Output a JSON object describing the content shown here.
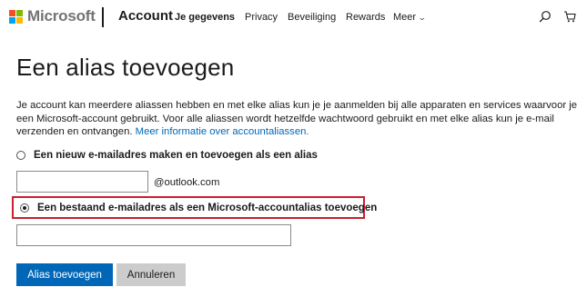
{
  "header": {
    "brand": "Microsoft",
    "section": "Account",
    "nav": [
      {
        "label": "Je gegevens",
        "active": true
      },
      {
        "label": "Privacy",
        "active": false
      },
      {
        "label": "Beveiliging",
        "active": false
      },
      {
        "label": "Rewards",
        "active": false
      },
      {
        "label": "Meer",
        "active": false
      }
    ],
    "icons": [
      "search-icon",
      "cart-icon",
      "chevron-down-icon"
    ]
  },
  "page": {
    "title": "Een alias toevoegen",
    "description": "Je account kan meerdere aliassen hebben en met elke alias kun je je aanmelden bij alle apparaten en services waarvoor je een Microsoft-account gebruikt. Voor alle aliassen wordt hetzelfde wachtwoord gebruikt en met elke alias kun je e-mail verzenden en ontvangen.",
    "more_info_link": "Meer informatie over accountaliassen."
  },
  "options": {
    "new_address": {
      "label": "Een nieuw e-mailadres maken en toevoegen als een alias",
      "checked": false,
      "input_value": "",
      "domain_suffix": "@outlook.com"
    },
    "existing_address": {
      "label": "Een bestaand e-mailadres als een Microsoft-accountalias toevoegen",
      "checked": true,
      "input_value": ""
    }
  },
  "buttons": {
    "add": "Alias toevoegen",
    "cancel": "Annuleren"
  },
  "colors": {
    "accent": "#0067b8",
    "highlight": "#c8202f",
    "secondary_button": "#cccccc"
  }
}
